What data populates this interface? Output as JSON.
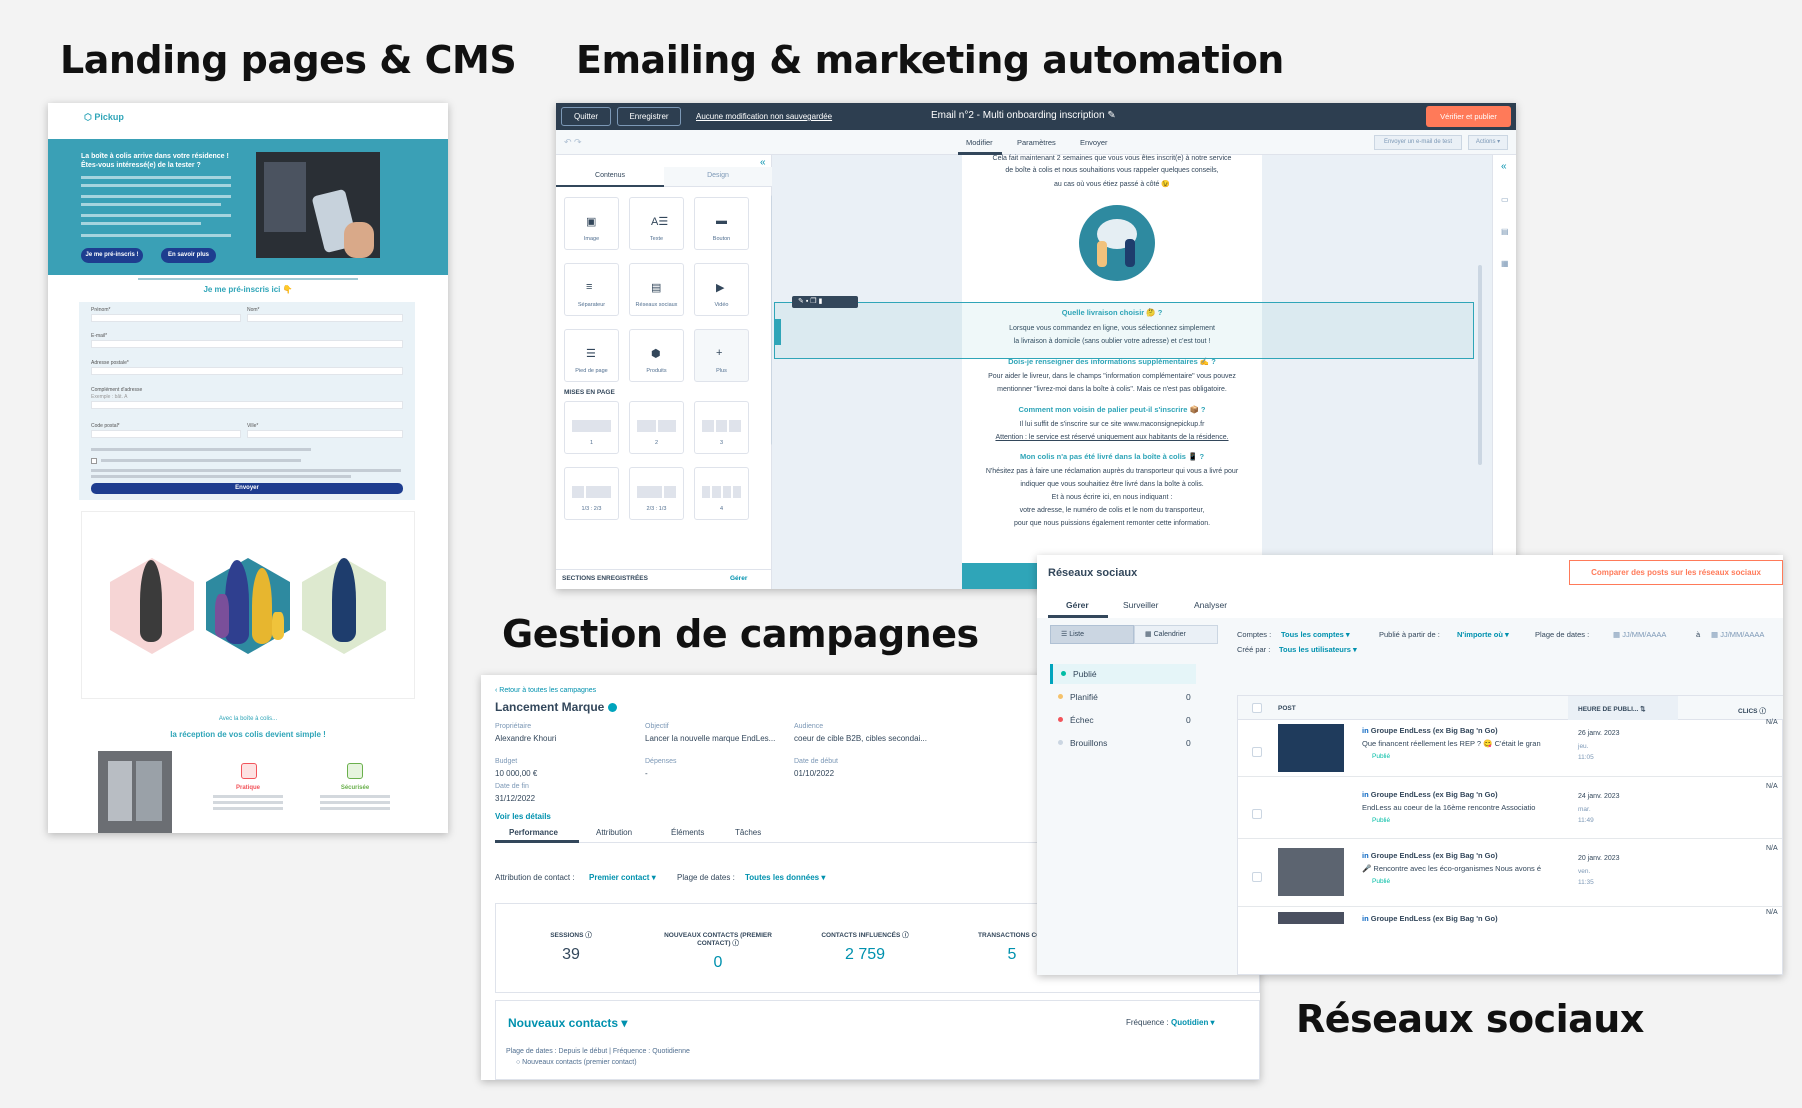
{
  "headings": {
    "landing": "Landing pages & CMS",
    "email": "Emailing & marketing automation",
    "campaigns": "Gestion de campagnes",
    "social": "Réseaux sociaux"
  },
  "landing": {
    "logo_text": "Pickup",
    "hero_title": "La boîte à colis arrive dans votre résidence ! Êtes-vous intéressé(e) de la tester ?",
    "btn_primary": "Je me pré-inscris !",
    "btn_secondary": "En savoir plus",
    "form_title": "Je me pré-inscris ici 👇",
    "form_fields": [
      "Prénom*",
      "Nom*",
      "E-mail*",
      "Adresse postale*",
      "Complément d'adresse",
      "Code postal*",
      "Ville*"
    ],
    "form_placeholder": "Exemple : bât. A",
    "submit": "Envoyer",
    "section_kicker": "Avec la boîte à colis...",
    "section_title": "la réception de vos colis devient simple !",
    "features": [
      "Pratique",
      "Sécurisée"
    ]
  },
  "email": {
    "btn_quit": "Quitter",
    "btn_save": "Enregistrer",
    "unsaved": "Aucune modification non sauvegardée",
    "title": "Email n°2 - Multi onboarding inscription",
    "btn_publish": "Vérifier et publier",
    "tabs": [
      "Modifier",
      "Paramètres",
      "Envoyer"
    ],
    "btn_test": "Envoyer un e-mail de test",
    "btn_actions": "Actions ▾",
    "panel_tabs": [
      "Contenus",
      "Design"
    ],
    "tiles": [
      "Image",
      "Texte",
      "Bouton",
      "Séparateur",
      "Réseaux sociaux",
      "Vidéo",
      "Pied de page",
      "Produits",
      "Plus"
    ],
    "layouts_title": "MISES EN PAGE",
    "layouts": [
      "1",
      "2",
      "3",
      "1/3 : 2/3",
      "2/3 : 1/3",
      "4"
    ],
    "saved_sections": "SECTIONS ENREGISTRÉES",
    "manage": "Gérer",
    "body_intro1": "Cela fait maintenant 2 semaines que vous vous êtes inscrit(e) à notre service",
    "body_intro2": "de boîte à colis et nous souhaitions vous rappeler quelques conseils,",
    "body_intro3": "au cas où vous étiez passé à côté 😉",
    "q1": "Quelle livraison choisir 🤔 ?",
    "a1_1": "Lorsque vous commandez en ligne, vous sélectionnez simplement",
    "a1_2": "la livraison à domicile (sans oublier votre adresse) et c'est tout !",
    "q2": "Dois-je renseigner des informations supplémentaires ✍ ?",
    "a2_1": "Pour aider le livreur, dans le champs \"information complémentaire\" vous pouvez",
    "a2_2": "mentionner \"livrez-moi dans la boîte à colis\". Mais ce n'est pas obligatoire.",
    "q3": "Comment mon voisin de palier peut-il s'inscrire 📦 ?",
    "a3_1": "Il lui suffit de s'inscrire sur ce site www.maconsignepickup.fr",
    "a3_2": "Attention : le service est réservé uniquement aux habitants de la résidence.",
    "q4": "Mon colis n'a pas été livré dans la boîte à colis 📱 ?",
    "a4_1": "N'hésitez pas à faire une réclamation auprès du transporteur qui vous a livré pour",
    "a4_2": "indiquer que vous souhaitiez être livré dans la boîte à colis.",
    "a4_3": "Et à nous écrire ici, en nous indiquant :",
    "a4_4": "votre adresse, le numéro de colis et le nom du transporteur,",
    "a4_5": "pour que nous puissions également remonter cette information."
  },
  "campaign": {
    "back": "‹ Retour à toutes les campagnes",
    "title": "Lancement Marque",
    "fields": [
      {
        "label": "Propriétaire",
        "value": "Alexandre Khouri"
      },
      {
        "label": "Objectif",
        "value": "Lancer la nouvelle marque EndLes..."
      },
      {
        "label": "Audience",
        "value": "coeur de cible B2B, cibles secondai..."
      },
      {
        "label": "Budget",
        "value": "10 000,00 €"
      },
      {
        "label": "Dépenses",
        "value": "-"
      },
      {
        "label": "Date de début",
        "value": "01/10/2022"
      },
      {
        "label": "Date de fin",
        "value": "31/12/2022"
      }
    ],
    "details_link": "Voir les détails",
    "tabs": [
      "Performance",
      "Attribution",
      "Éléments",
      "Tâches"
    ],
    "filter_attr_label": "Attribution de contact :",
    "filter_attr_value": "Premier contact ▾",
    "filter_date_label": "Plage de dates :",
    "filter_date_value": "Toutes les données ▾",
    "kpis": [
      {
        "label": "SESSIONS ⓘ",
        "value": "39"
      },
      {
        "label": "NOUVEAUX CONTACTS (PREMIER CONTACT) ⓘ",
        "value": "0"
      },
      {
        "label": "CONTACTS INFLUENCÉS ⓘ",
        "value": "2 759"
      },
      {
        "label": "TRANSACTIONS CON",
        "value": "5"
      }
    ],
    "new_contacts": "Nouveaux contacts ▾",
    "frequency_label": "Fréquence :",
    "frequency_value": "Quotidien ▾",
    "footnote": "Plage de dates : Depuis le début   |   Fréquence : Quotidienne",
    "legend": "○ Nouveaux contacts (premier contact)"
  },
  "social": {
    "title": "Réseaux sociaux",
    "compare_btn": "Comparer des posts sur les réseaux sociaux",
    "tabs": [
      "Gérer",
      "Surveiller",
      "Analyser"
    ],
    "view_list": "☰ Liste",
    "view_cal": "Calendrier",
    "status": [
      {
        "label": "Publié",
        "count": ""
      },
      {
        "label": "Planifié",
        "count": "0"
      },
      {
        "label": "Échec",
        "count": "0"
      },
      {
        "label": "Brouillons",
        "count": "0"
      }
    ],
    "colors": {
      "published": "#00bda5",
      "scheduled": "#f5c26b",
      "failed": "#f2545b",
      "draft": "#cbd6e2"
    },
    "filter_accounts_label": "Comptes :",
    "filter_accounts_value": "Tous les comptes ▾",
    "filter_from_label": "Publié à partir de :",
    "filter_from_value": "N'importe où ▾",
    "filter_dates_label": "Plage de dates :",
    "date_placeholder": "JJ/MM/AAAA",
    "date_sep": "à",
    "filter_by_label": "Créé par :",
    "filter_by_value": "Tous les utilisateurs ▾",
    "columns": [
      "POST",
      "HEURE DE PUBLI...",
      "CLICS"
    ],
    "rows": [
      {
        "account": "Groupe EndLess (ex Big Bag 'n Go)",
        "text": "Que financent réellement les REP ? 😋 C'était le gran",
        "status": "Publié",
        "date": "26 janv. 2023",
        "day": "jeu.",
        "time": "11:05",
        "clicks": "N/A"
      },
      {
        "account": "Groupe EndLess (ex Big Bag 'n Go)",
        "text": "EndLess au coeur de la 16ème rencontre Associatio",
        "status": "Publié",
        "date": "24 janv. 2023",
        "day": "mar.",
        "time": "11:49",
        "clicks": "N/A"
      },
      {
        "account": "Groupe EndLess (ex Big Bag 'n Go)",
        "text": "🎤 Rencontre avec les éco-organismes Nous avons é",
        "status": "Publié",
        "date": "20 janv. 2023",
        "day": "ven.",
        "time": "11:35",
        "clicks": "N/A"
      },
      {
        "account": "Groupe EndLess (ex Big Bag 'n Go)",
        "text": "",
        "status": "",
        "date": "",
        "day": "",
        "time": "",
        "clicks": "N/A"
      }
    ]
  }
}
